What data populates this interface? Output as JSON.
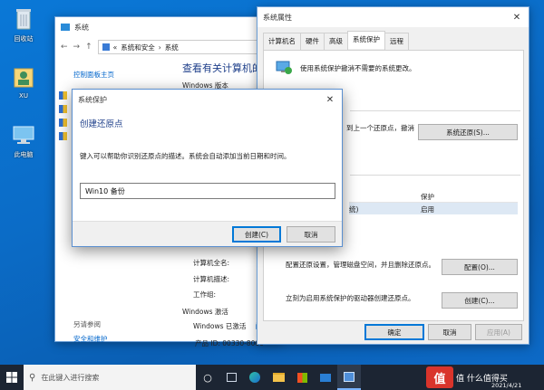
{
  "desktop": {
    "icons": [
      {
        "label": "回收站"
      },
      {
        "label": "XU"
      },
      {
        "label": "此电脑"
      }
    ]
  },
  "system_window": {
    "title": "系统",
    "address": {
      "part1": "系统和安全",
      "part2": "系统"
    },
    "left_links": [
      "控制面板主页",
      "另请参阅",
      "安全和维护"
    ],
    "heading": "查看有关计算机的基",
    "windows_edition": "Windows 版本",
    "rows": {
      "full_name": "计算机全名:",
      "description": "计算机描述:",
      "workgroup": "工作组:"
    },
    "activation_header": "Windows 激活",
    "activated": "Windows 已激活",
    "activated_link": "阅",
    "product_id": "产品 ID: 00330-8000"
  },
  "properties_window": {
    "title": "系统属性",
    "tabs": [
      "计算机名",
      "硬件",
      "高级",
      "系统保护",
      "远程"
    ],
    "active_tab": "系统保护",
    "intro": "使用系统保护撤消不需要的系统更改。",
    "restore_text": "到上一个还原点，撤消",
    "restore_button": "系统还原(S)...",
    "col_protection": "保护",
    "drive_row": "统)",
    "drive_status": "启用",
    "config_text": "配置还原设置，管理磁盘空间，并且删除还原点。",
    "config_button": "配置(O)...",
    "create_text": "立刻为启用系统保护的驱动器创建还原点。",
    "create_button": "创建(C)...",
    "ok_button": "确定",
    "cancel_button": "取消",
    "apply_button": "应用(A)"
  },
  "dialog": {
    "title": "系统保护",
    "heading": "创建还原点",
    "description": "键入可以帮助你识别还原点的描述。系统会自动添加当前日期和时间。",
    "input_value": "Win10 备份",
    "create_button": "创建(C)",
    "cancel_button": "取消"
  },
  "taskbar": {
    "search_placeholder": "在此键入进行搜索",
    "date": "2021/4/21"
  },
  "watermark": "值 什么值得买",
  "colors": {
    "accent": "#0078d7",
    "link": "#0066cc",
    "taskbar": "#1c2533"
  }
}
